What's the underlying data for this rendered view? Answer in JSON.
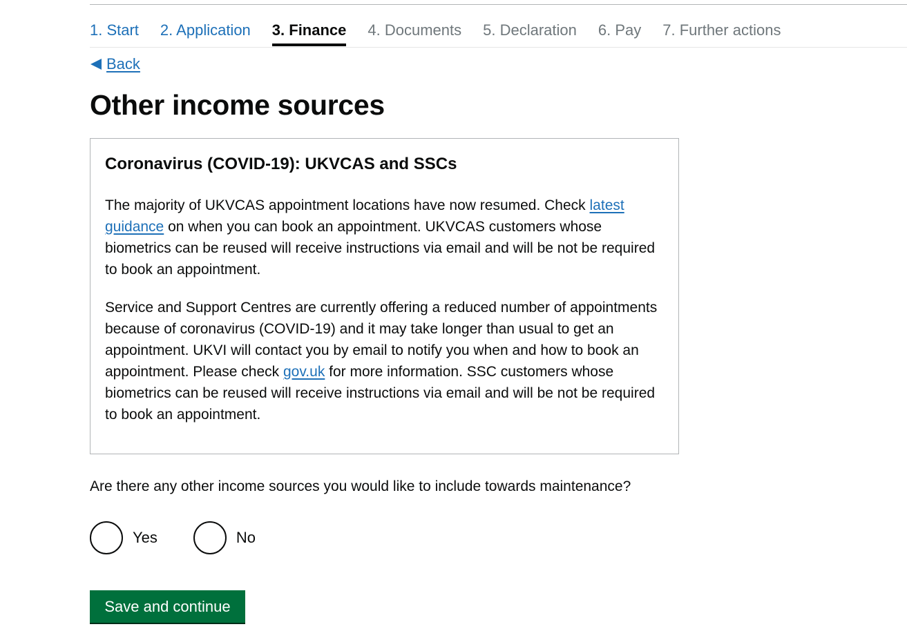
{
  "steps": [
    {
      "label": "1. Start",
      "state": "done"
    },
    {
      "label": "2. Application",
      "state": "done"
    },
    {
      "label": "3. Finance",
      "state": "current"
    },
    {
      "label": "4. Documents",
      "state": "future"
    },
    {
      "label": "5. Declaration",
      "state": "future"
    },
    {
      "label": "6. Pay",
      "state": "future"
    },
    {
      "label": "7. Further actions",
      "state": "future"
    }
  ],
  "back_link": "Back",
  "page_title": "Other income sources",
  "notice": {
    "heading": "Coronavirus (COVID-19): UKVCAS and SSCs",
    "p1_before": "The majority of UKVCAS appointment locations have now resumed. Check ",
    "p1_link": "latest guidance",
    "p1_after": " on when you can book an appointment. UKVCAS customers whose biometrics can be reused will receive instructions via email and will be not be required to book an appointment.",
    "p2_before": "Service and Support Centres are currently offering a reduced number of appointments because of coronavirus (COVID-19) and it may take longer than usual to get an appointment. UKVI will contact you by email to notify you when and how to book an appointment. Please check ",
    "p2_link": "gov.uk",
    "p2_after": " for more information. SSC customers whose biometrics can be reused will receive instructions via email and will be not be required to book an appointment."
  },
  "question": "Are there any other income sources you would like to include towards maintenance?",
  "options": {
    "yes": "Yes",
    "no": "No"
  },
  "save_button": "Save and continue",
  "colors": {
    "link": "#1d70b8",
    "button": "#00703c",
    "text": "#0b0c0c"
  }
}
